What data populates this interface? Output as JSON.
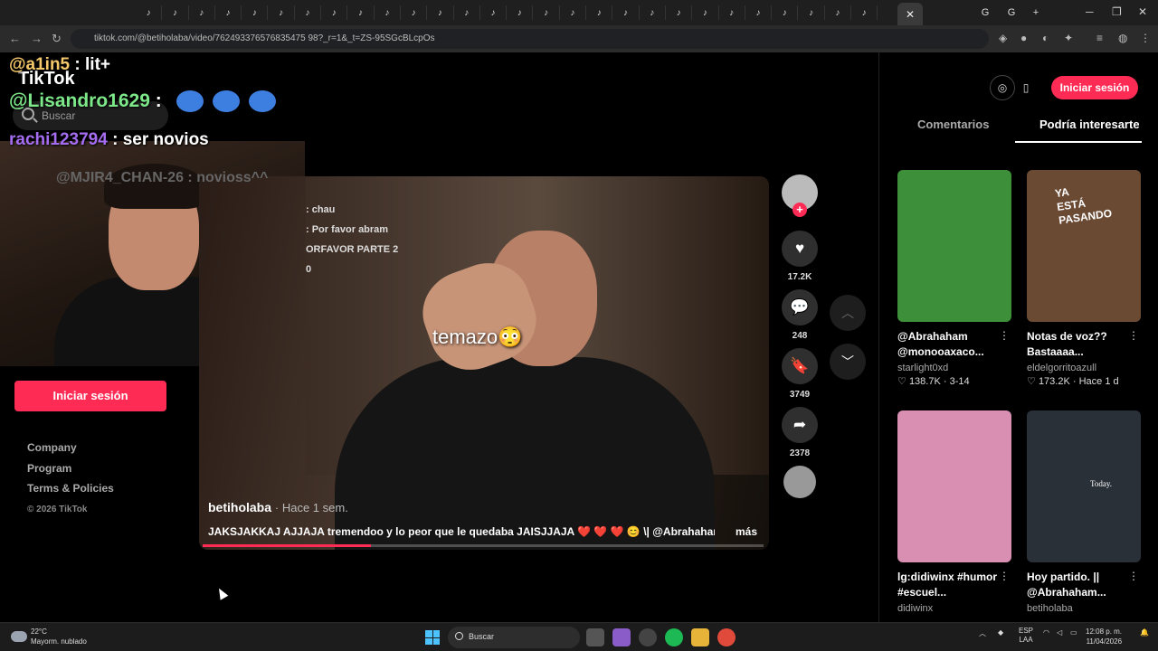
{
  "browser": {
    "url": "tiktok.com/@betiholaba/video/762493376576835475 98?_r=1&_t=ZS-95SGcBLcpOs",
    "tab_count_icons": 28,
    "new_tab": "+",
    "close_tab": "✕"
  },
  "overlay_chat": {
    "line1_user": "@a1in5",
    "line1_text": ": lit+",
    "line2_user": "@Lisandro1629",
    "line2_sep": ":",
    "line3_user": "rachi123794",
    "line3_text": ": ser novios",
    "line4": "@MJIR4_CHAN-26 : novioss^^"
  },
  "sidebar": {
    "logo": "TikTok",
    "search_placeholder": "Buscar",
    "login_button": "Iniciar sesión",
    "links": [
      "Company",
      "Program",
      "Terms & Policies"
    ],
    "copyright": "© 2026 TikTok"
  },
  "video": {
    "stream_chat": [
      ": chau",
      ": Por favor abram",
      "ORFAVOR PARTE 2",
      "0"
    ],
    "caption_overlay": "temazo😳",
    "author": "betiholaba",
    "time_ago": "· Hace 1 sem.",
    "description": "JAKSJAKKAJ AJJAJA  tremendoo y lo peor que le quedaba JAISJJAJA ❤️ ❤️ ❤️ 😊 \\| @Abrahaham ...",
    "more": "más",
    "progress_fraction": 0.3
  },
  "actions": {
    "likes": "17.2K",
    "comments": "248",
    "saves": "3749",
    "shares": "2378",
    "follow_plus": "+"
  },
  "right_panel": {
    "login_button": "Iniciar sesión",
    "tabs": [
      "Comentarios",
      "Podría interesarte"
    ],
    "cards": [
      {
        "title": "@Abrahaham @monooaxaco...",
        "author": "starlight0xd",
        "likes": "138.7K",
        "date": "3-14",
        "color": "#3e8f3a"
      },
      {
        "title": "Notas de voz?? Bastaaaa...",
        "author": "eldelgorritoazull",
        "likes": "173.2K",
        "date": "Hace 1 d",
        "color": "#6b4a34",
        "thumb_text": "YA ESTÁ PASANDO"
      },
      {
        "title": "lg:didiwinx #humor #escuel...",
        "author": "didiwinx",
        "color": "#d98fb2"
      },
      {
        "title": "Hoy partido. || @Abrahaham...",
        "author": "betiholaba",
        "color": "#2a3038",
        "thumb_text": "Today."
      }
    ]
  },
  "taskbar": {
    "temp": "22°C",
    "weather": "Mayorm. nublado",
    "search": "Buscar",
    "lang1": "ESP",
    "lang2": "LAA",
    "time": "12:08 p. m.",
    "date": "11/04/2026"
  }
}
